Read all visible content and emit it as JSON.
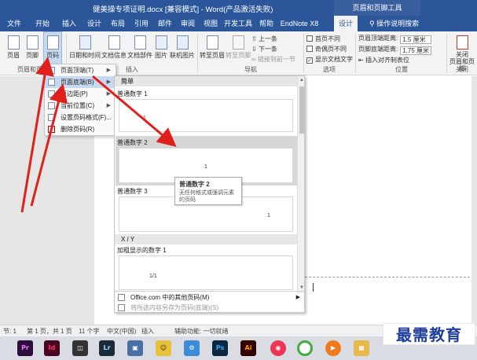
{
  "window": {
    "title": "健美操专项证明.docx [兼容模式] - Word(产品激活失败)",
    "context_title": "页眉和页脚工具"
  },
  "tabs": [
    "文件",
    "开始",
    "插入",
    "设计",
    "布局",
    "引用",
    "邮件",
    "审阅",
    "视图",
    "开发工具",
    "帮助",
    "EndNote X8",
    "设计"
  ],
  "tell_me": "操作说明搜索",
  "ribbon": {
    "groups": {
      "header_footer": "页眉和页脚",
      "insert": "插入",
      "navigation": "导航",
      "options": "选项",
      "position": "位置",
      "close": "关闭"
    },
    "buttons": {
      "header": "页眉",
      "footer": "页脚",
      "page_number": "页码",
      "date_time": "日期和时间",
      "doc_info": "文档信息",
      "doc_parts": "文档部件",
      "picture": "图片",
      "online_pictures": "联机图片",
      "goto_header": "转至页眉",
      "goto_footer": "转至页脚",
      "close_header_footer": "关闭\n页眉和页脚"
    },
    "navigation": {
      "previous": "上一条",
      "next": "下一条",
      "link_previous": "链接到前一节"
    },
    "options": {
      "different_first_page": "首页不同",
      "different_odd_even": "奇偶页不同",
      "show_document_text": "显示文档文字"
    },
    "position": {
      "header_from_top_label": "页眉顶端距离:",
      "header_from_top_value": "1.5 厘米",
      "footer_from_bottom_label": "页脚底端距离:",
      "footer_from_bottom_value": "1.75 厘米",
      "insert_alignment_tab": "插入对齐制表位"
    }
  },
  "page_number_menu": {
    "items": [
      {
        "label": "页面顶端(T)",
        "has_submenu": true
      },
      {
        "label": "页面底端(B)",
        "has_submenu": true
      },
      {
        "label": "页边距(P)",
        "has_submenu": true
      },
      {
        "label": "当前位置(C)",
        "has_submenu": true
      },
      {
        "label": "设置页码格式(F)...",
        "has_submenu": false
      },
      {
        "label": "删除页码(R)",
        "has_submenu": false
      }
    ]
  },
  "gallery": {
    "section_simple": "简单",
    "items": [
      {
        "label": "普通数字 1",
        "num": "1"
      },
      {
        "label": "普通数字 2",
        "num": "1"
      },
      {
        "label": "普通数字 3",
        "num": "1"
      }
    ],
    "section_xy": "X / Y",
    "bold_item": {
      "label": "加粗显示的数字 1",
      "num": "1/1"
    },
    "more_online": "Office.com 中的其他页码(M)",
    "save_selection": "将所选内容另存为页码(底端)(S)"
  },
  "tooltip": {
    "title": "普通数字 2",
    "text": "无任何格式或强调元素的页码"
  },
  "statusbar": {
    "section": "节: 1",
    "page": "第 1 页，共 1 页",
    "words": "11 个字",
    "language": "中文(中国)",
    "insert_mode": "插入",
    "accessibility": "辅助功能: 一切就绪"
  },
  "taskbar": [
    "Pr",
    "Id",
    "Lr",
    "Ps",
    "Ai"
  ],
  "watermark": "最需教育",
  "colors": {
    "word_blue": "#2b579a",
    "arrow_red": "#e0201b",
    "highlight": "#c5d9f1"
  }
}
